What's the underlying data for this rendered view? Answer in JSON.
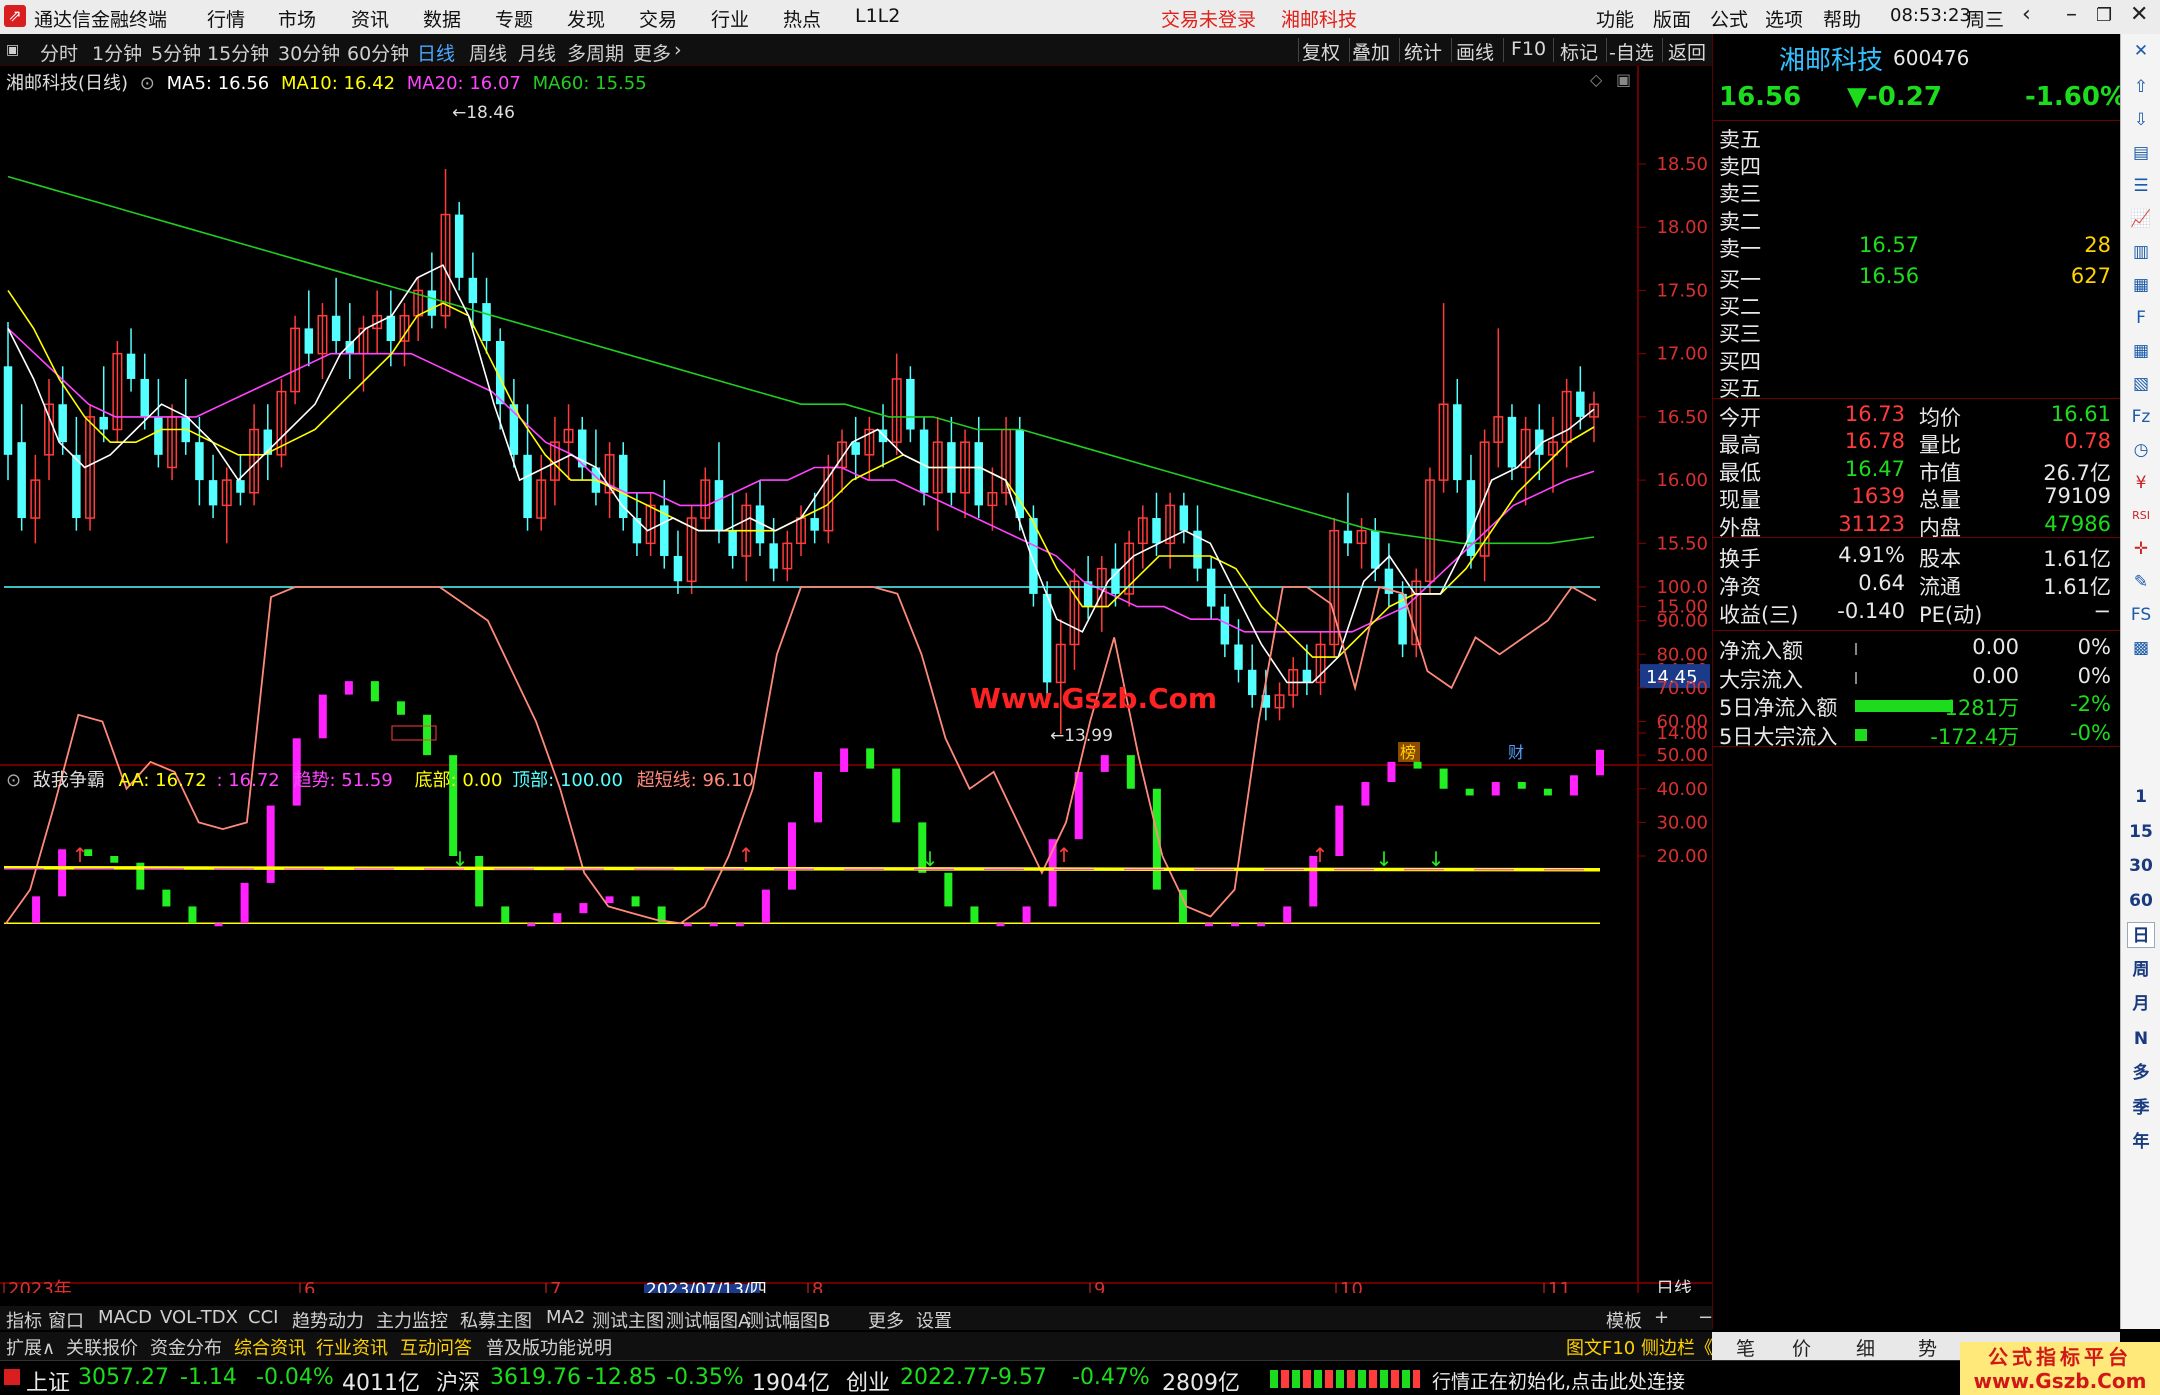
{
  "titlebar": {
    "app_name": "通达信金融终端",
    "menus": [
      "行情",
      "市场",
      "资讯",
      "数据",
      "专题",
      "发现",
      "交易",
      "行业",
      "热点",
      "L1L2"
    ],
    "login_status": "交易未登录",
    "current_stock": "湘邮科技",
    "right_menus": [
      "功能",
      "版面",
      "公式",
      "选项",
      "帮助"
    ],
    "clock": "08:53:23",
    "weekday": "周三"
  },
  "periodbar": {
    "periods": [
      "分时",
      "1分钟",
      "5分钟",
      "15分钟",
      "30分钟",
      "60分钟",
      "日线",
      "周线",
      "月线",
      "多周期",
      "更多"
    ],
    "active": "日线",
    "tools": [
      "复权",
      "叠加",
      "统计",
      "画线",
      "F10",
      "标记",
      "-自选",
      "返回"
    ]
  },
  "main_chart": {
    "legend_title": "湘邮科技(日线)",
    "ma5_label": "MA5: 16.56",
    "ma10_label": "MA10: 16.42",
    "ma20_label": "MA20: 16.07",
    "ma60_label": "MA60: 15.55",
    "high_mark": "18.46",
    "low_mark": "13.99",
    "price_axis": [
      "18.50",
      "18.00",
      "17.50",
      "17.00",
      "16.50",
      "16.00",
      "15.50",
      "15.00",
      "14.50",
      "14.00"
    ],
    "cursor_price": "14.45",
    "badge_bang": "榜",
    "badge_cai": "财",
    "colors": {
      "up": "#ff3b3b",
      "down": "#54ffff",
      "ma5": "#ffffff",
      "ma10": "#ffff00",
      "ma20": "#ff44ff",
      "ma60": "#22cc22"
    }
  },
  "indicator": {
    "name": "敌我争霸",
    "aa_label": "AA: 16.72",
    "aa2_label": ": 16.72",
    "trend_label": "趋势: 51.59",
    "bottom_label": "底部: 0.00",
    "top_label": "顶部: 100.00",
    "overshort_label": "超短线: 96.10",
    "axis": [
      "100.0",
      "90.00",
      "80.00",
      "70.00",
      "60.00",
      "50.00",
      "40.00",
      "30.00",
      "20.00"
    ]
  },
  "date_axis": {
    "labels": [
      "2023年",
      "6",
      "7",
      "8",
      "9",
      "10",
      "11"
    ],
    "cursor_date": "2023/07/13/四",
    "period": "日线"
  },
  "bottom_tabs": [
    "指标",
    "窗口",
    "MACD",
    "VOL-TDX",
    "CCI",
    "趋势动力",
    "主力监控",
    "私募主图",
    "MA2",
    "测试主图",
    "测试幅图A",
    "测试幅图B",
    "更多",
    "设置"
  ],
  "bottom_tabs_right": [
    "模板",
    "+",
    "−"
  ],
  "bottom_tabs2": [
    "扩展∧",
    "关联报价",
    "资金分布",
    "综合资讯",
    "行业资讯",
    "互动问答",
    "普及版功能说明"
  ],
  "bottom_tabs2_right": "图文F10 侧边栏《",
  "quote": {
    "name": "湘邮科技",
    "code": "600476",
    "price": "16.56",
    "change": "▼-0.27",
    "pct": "-1.60%",
    "sell": [
      {
        "label": "卖五",
        "price": "",
        "vol": ""
      },
      {
        "label": "卖四",
        "price": "",
        "vol": ""
      },
      {
        "label": "卖三",
        "price": "",
        "vol": ""
      },
      {
        "label": "卖二",
        "price": "",
        "vol": ""
      },
      {
        "label": "卖一",
        "price": "16.57",
        "vol": "28"
      }
    ],
    "buy": [
      {
        "label": "买一",
        "price": "16.56",
        "vol": "627"
      },
      {
        "label": "买二",
        "price": "",
        "vol": ""
      },
      {
        "label": "买三",
        "price": "",
        "vol": ""
      },
      {
        "label": "买四",
        "price": "",
        "vol": ""
      },
      {
        "label": "买五",
        "price": "",
        "vol": ""
      }
    ],
    "stats": [
      {
        "l1": "今开",
        "v1": "16.73",
        "l2": "均价",
        "v2": "16.61"
      },
      {
        "l1": "最高",
        "v1": "16.78",
        "l2": "量比",
        "v2": "0.78"
      },
      {
        "l1": "最低",
        "v1": "16.47",
        "l2": "市值",
        "v2": "26.7亿"
      },
      {
        "l1": "现量",
        "v1": "1639",
        "l2": "总量",
        "v2": "79109"
      },
      {
        "l1": "外盘",
        "v1": "31123",
        "l2": "内盘",
        "v2": "47986"
      }
    ],
    "stats2": [
      {
        "l1": "换手",
        "v1": "4.91%",
        "l2": "股本",
        "v2": "1.61亿"
      },
      {
        "l1": "净资",
        "v1": "0.64",
        "l2": "流通",
        "v2": "1.61亿"
      },
      {
        "l1": "收益(三)",
        "v1": "-0.140",
        "l2": "PE(动)",
        "v2": "−"
      }
    ],
    "flows": [
      {
        "label": "净流入额",
        "val": "0.00",
        "pct": "0%",
        "bar": 0.0
      },
      {
        "label": "大宗流入",
        "val": "0.00",
        "pct": "0%",
        "bar": 0.0
      },
      {
        "label": "5日净流入额",
        "val": "-1281万",
        "pct": "-2%",
        "bar": 0.94
      },
      {
        "label": "5日大宗流入",
        "val": "-172.4万",
        "pct": "-0%",
        "bar": 0.12
      }
    ]
  },
  "right_tabs": [
    "笔",
    "价",
    "细",
    "势"
  ],
  "side_icons": [
    "up-arrow-icon",
    "down-arrow-icon",
    "quote-icon",
    "list-icon",
    "chart-icon",
    "kline-icon",
    "news-icon",
    "f10-icon",
    "grid-icon",
    "news2-icon",
    "fz-icon",
    "clock-icon",
    "money-icon",
    "rsi-icon",
    "crosshair-icon",
    "pen-icon",
    "fs-icon",
    "vol-icon"
  ],
  "side_periods": [
    "1",
    "15",
    "30",
    "60",
    "日",
    "周",
    "月",
    "N",
    "多",
    "季",
    "年"
  ],
  "statusbar": {
    "sh": {
      "name": "上证",
      "val": "3057.27",
      "chg": "-1.14",
      "pct": "-0.04%",
      "amt": "4011亿"
    },
    "hs": {
      "name": "沪深",
      "val": "3619.76",
      "chg": "-12.85",
      "pct": "-0.35%",
      "amt": "1904亿"
    },
    "cy": {
      "name": "创业",
      "val": "2022.77",
      "chg": "-9.57",
      "pct": "-0.47%",
      "amt": "2809亿"
    },
    "message": "行情正在初始化,点击此处连接"
  },
  "watermarks": {
    "center": "Www.Gszb.Com",
    "corner_line1": "公式指标平台",
    "corner_line2": "www.Gszb.Com"
  },
  "chart_data": {
    "type": "candlestick",
    "ohlc_note": "daily candles approximating chart, price units",
    "candles": [
      [
        16.9,
        17.25,
        16.0,
        16.2
      ],
      [
        16.3,
        16.6,
        15.6,
        15.7
      ],
      [
        15.7,
        16.2,
        15.5,
        16.0
      ],
      [
        16.2,
        16.8,
        16.0,
        16.6
      ],
      [
        16.6,
        16.9,
        16.2,
        16.3
      ],
      [
        16.2,
        16.5,
        15.6,
        15.7
      ],
      [
        15.7,
        16.6,
        15.6,
        16.5
      ],
      [
        16.5,
        16.9,
        16.3,
        16.4
      ],
      [
        16.4,
        17.1,
        16.3,
        17.0
      ],
      [
        17.0,
        17.2,
        16.7,
        16.8
      ],
      [
        16.8,
        17.0,
        16.4,
        16.5
      ],
      [
        16.5,
        16.8,
        16.1,
        16.2
      ],
      [
        16.1,
        16.6,
        16.0,
        16.5
      ],
      [
        16.5,
        16.8,
        16.2,
        16.3
      ],
      [
        16.3,
        16.5,
        15.8,
        16.0
      ],
      [
        16.0,
        16.2,
        15.7,
        15.8
      ],
      [
        15.8,
        16.1,
        15.5,
        16.0
      ],
      [
        16.0,
        16.2,
        15.8,
        15.9
      ],
      [
        15.9,
        16.6,
        15.8,
        16.4
      ],
      [
        16.4,
        16.6,
        16.0,
        16.2
      ],
      [
        16.2,
        16.8,
        16.1,
        16.7
      ],
      [
        16.7,
        17.3,
        16.6,
        17.2
      ],
      [
        17.2,
        17.5,
        16.9,
        17.0
      ],
      [
        17.0,
        17.4,
        16.8,
        17.3
      ],
      [
        17.3,
        17.6,
        17.0,
        17.1
      ],
      [
        17.1,
        17.4,
        16.8,
        17.0
      ],
      [
        17.0,
        17.3,
        16.7,
        17.2
      ],
      [
        17.2,
        17.5,
        17.0,
        17.3
      ],
      [
        17.3,
        17.5,
        16.9,
        17.1
      ],
      [
        17.1,
        17.4,
        16.9,
        17.3
      ],
      [
        17.3,
        17.6,
        17.1,
        17.5
      ],
      [
        17.5,
        17.8,
        17.2,
        17.3
      ],
      [
        17.3,
        18.46,
        17.2,
        18.1
      ],
      [
        18.1,
        18.2,
        17.5,
        17.6
      ],
      [
        17.6,
        17.8,
        17.2,
        17.4
      ],
      [
        17.4,
        17.6,
        17.0,
        17.1
      ],
      [
        17.1,
        17.2,
        16.4,
        16.6
      ],
      [
        16.6,
        16.8,
        16.1,
        16.2
      ],
      [
        16.2,
        16.6,
        15.6,
        15.7
      ],
      [
        15.7,
        16.2,
        15.6,
        16.0
      ],
      [
        16.0,
        16.5,
        15.8,
        16.3
      ],
      [
        16.3,
        16.6,
        16.0,
        16.4
      ],
      [
        16.4,
        16.5,
        16.0,
        16.1
      ],
      [
        16.1,
        16.4,
        15.8,
        15.9
      ],
      [
        15.9,
        16.3,
        15.7,
        16.2
      ],
      [
        16.2,
        16.3,
        15.6,
        15.7
      ],
      [
        15.7,
        15.9,
        15.4,
        15.5
      ],
      [
        15.5,
        15.9,
        15.4,
        15.8
      ],
      [
        15.8,
        16.0,
        15.3,
        15.4
      ],
      [
        15.4,
        15.6,
        15.1,
        15.2
      ],
      [
        15.2,
        15.8,
        15.1,
        15.7
      ],
      [
        15.7,
        16.1,
        15.6,
        16.0
      ],
      [
        16.0,
        16.3,
        15.5,
        15.6
      ],
      [
        15.6,
        15.9,
        15.3,
        15.4
      ],
      [
        15.4,
        15.9,
        15.2,
        15.8
      ],
      [
        15.8,
        16.0,
        15.4,
        15.5
      ],
      [
        15.5,
        15.7,
        15.2,
        15.3
      ],
      [
        15.3,
        15.6,
        15.2,
        15.5
      ],
      [
        15.5,
        15.8,
        15.4,
        15.7
      ],
      [
        15.7,
        15.9,
        15.5,
        15.6
      ],
      [
        15.6,
        16.2,
        15.5,
        16.1
      ],
      [
        16.1,
        16.4,
        15.9,
        16.3
      ],
      [
        16.3,
        16.5,
        16.0,
        16.2
      ],
      [
        16.2,
        16.5,
        16.0,
        16.4
      ],
      [
        16.4,
        16.6,
        16.1,
        16.3
      ],
      [
        16.3,
        17.0,
        16.2,
        16.8
      ],
      [
        16.8,
        16.9,
        16.3,
        16.4
      ],
      [
        16.4,
        16.5,
        15.8,
        15.9
      ],
      [
        15.9,
        16.5,
        15.6,
        16.3
      ],
      [
        16.3,
        16.5,
        15.8,
        15.9
      ],
      [
        15.9,
        16.4,
        15.7,
        16.3
      ],
      [
        16.3,
        16.5,
        15.7,
        15.8
      ],
      [
        15.8,
        16.1,
        15.6,
        15.9
      ],
      [
        15.9,
        16.5,
        15.8,
        16.4
      ],
      [
        16.4,
        16.5,
        15.6,
        15.7
      ],
      [
        15.7,
        15.8,
        15.0,
        15.1
      ],
      [
        15.1,
        15.2,
        14.2,
        14.4
      ],
      [
        14.4,
        14.9,
        13.99,
        14.7
      ],
      [
        14.7,
        15.3,
        14.5,
        15.2
      ],
      [
        15.2,
        15.4,
        14.9,
        15.0
      ],
      [
        15.0,
        15.4,
        14.8,
        15.3
      ],
      [
        15.3,
        15.5,
        15.0,
        15.1
      ],
      [
        15.1,
        15.6,
        15.0,
        15.5
      ],
      [
        15.5,
        15.8,
        15.3,
        15.7
      ],
      [
        15.7,
        15.9,
        15.4,
        15.5
      ],
      [
        15.5,
        15.9,
        15.3,
        15.8
      ],
      [
        15.8,
        15.9,
        15.5,
        15.6
      ],
      [
        15.6,
        15.8,
        15.2,
        15.3
      ],
      [
        15.3,
        15.4,
        14.9,
        15.0
      ],
      [
        15.0,
        15.1,
        14.6,
        14.7
      ],
      [
        14.7,
        14.9,
        14.4,
        14.5
      ],
      [
        14.5,
        14.7,
        14.2,
        14.3
      ],
      [
        14.3,
        14.5,
        14.1,
        14.2
      ],
      [
        14.2,
        14.4,
        14.1,
        14.3
      ],
      [
        14.3,
        14.6,
        14.2,
        14.5
      ],
      [
        14.5,
        14.7,
        14.3,
        14.4
      ],
      [
        14.4,
        14.8,
        14.3,
        14.7
      ],
      [
        14.7,
        15.7,
        14.6,
        15.6
      ],
      [
        15.6,
        15.9,
        15.4,
        15.5
      ],
      [
        15.5,
        15.7,
        15.3,
        15.6
      ],
      [
        15.6,
        15.7,
        15.2,
        15.3
      ],
      [
        15.3,
        15.5,
        15.0,
        15.1
      ],
      [
        15.1,
        15.2,
        14.6,
        14.7
      ],
      [
        14.7,
        15.3,
        14.6,
        15.2
      ],
      [
        15.2,
        16.1,
        15.1,
        16.0
      ],
      [
        16.0,
        17.4,
        15.9,
        16.6
      ],
      [
        16.6,
        16.8,
        15.9,
        16.0
      ],
      [
        16.0,
        16.2,
        15.3,
        15.4
      ],
      [
        15.4,
        16.4,
        15.2,
        16.3
      ],
      [
        16.3,
        17.2,
        16.1,
        16.5
      ],
      [
        16.5,
        16.6,
        16.0,
        16.1
      ],
      [
        16.1,
        16.5,
        15.8,
        16.4
      ],
      [
        16.4,
        16.6,
        16.0,
        16.2
      ],
      [
        16.2,
        16.5,
        15.9,
        16.3
      ],
      [
        16.3,
        16.8,
        16.1,
        16.7
      ],
      [
        16.7,
        16.9,
        16.4,
        16.5
      ],
      [
        16.5,
        16.7,
        16.3,
        16.6
      ]
    ],
    "ma": {
      "ma5": [
        17.2,
        16.8,
        16.3,
        16.1,
        16.2,
        16.4,
        16.6,
        16.5,
        16.3,
        16.0,
        16.2,
        16.4,
        16.6,
        17.0,
        17.2,
        17.3,
        17.6,
        17.7,
        17.3,
        16.6,
        16.0,
        16.1,
        16.2,
        16.1,
        15.8,
        15.6,
        15.7,
        15.6,
        15.6,
        15.7,
        15.6,
        15.7,
        16.0,
        16.3,
        16.4,
        16.2,
        16.1,
        16.1,
        16.1,
        16.0,
        15.4,
        14.9,
        14.8,
        15.2,
        15.4,
        15.5,
        15.6,
        15.5,
        15.1,
        14.7,
        14.4,
        14.4,
        14.6,
        15.2,
        15.4,
        15.1,
        15.1,
        15.5,
        16.0,
        16.1,
        16.3,
        16.4,
        16.56
      ],
      "ma10": [
        17.5,
        17.2,
        16.8,
        16.5,
        16.3,
        16.3,
        16.4,
        16.4,
        16.3,
        16.2,
        16.2,
        16.3,
        16.4,
        16.6,
        16.8,
        17.0,
        17.3,
        17.4,
        17.3,
        16.9,
        16.5,
        16.2,
        16.0,
        16.0,
        15.9,
        15.8,
        15.7,
        15.6,
        15.6,
        15.6,
        15.6,
        15.7,
        15.8,
        16.0,
        16.1,
        16.2,
        16.1,
        16.1,
        16.1,
        16.0,
        15.7,
        15.3,
        15.0,
        15.0,
        15.2,
        15.4,
        15.4,
        15.4,
        15.3,
        15.0,
        14.8,
        14.6,
        14.6,
        14.8,
        15.0,
        15.1,
        15.1,
        15.3,
        15.6,
        15.9,
        16.1,
        16.3,
        16.42
      ],
      "ma20": [
        17.2,
        17.0,
        16.8,
        16.6,
        16.5,
        16.5,
        16.5,
        16.5,
        16.6,
        16.7,
        16.8,
        16.9,
        17.0,
        17.0,
        17.0,
        17.0,
        16.9,
        16.8,
        16.7,
        16.5,
        16.3,
        16.2,
        16.0,
        15.9,
        15.9,
        15.8,
        15.8,
        15.9,
        16.0,
        16.0,
        16.1,
        16.1,
        16.0,
        16.0,
        15.9,
        15.8,
        15.7,
        15.6,
        15.5,
        15.4,
        15.2,
        15.1,
        15.0,
        15.0,
        14.9,
        14.9,
        14.8,
        14.8,
        14.8,
        14.8,
        14.8,
        14.9,
        15.0,
        15.2,
        15.4,
        15.6,
        15.8,
        15.9,
        16.0,
        16.07
      ],
      "ma60": [
        18.4,
        18.3,
        18.2,
        18.1,
        18.0,
        17.9,
        17.8,
        17.7,
        17.6,
        17.5,
        17.4,
        17.3,
        17.2,
        17.1,
        17.0,
        16.9,
        16.8,
        16.7,
        16.6,
        16.6,
        16.5,
        16.5,
        16.4,
        16.4,
        16.3,
        16.2,
        16.1,
        16.0,
        15.9,
        15.8,
        15.7,
        15.6,
        15.55,
        15.5,
        15.5,
        15.5,
        15.55
      ]
    },
    "indicator_series": {
      "overshort_line": [
        0,
        10,
        35,
        62,
        60,
        40,
        48,
        45,
        30,
        28,
        30,
        97,
        100,
        100,
        100,
        100,
        100,
        100,
        100,
        95,
        90,
        75,
        60,
        40,
        15,
        5,
        3,
        1,
        0,
        5,
        20,
        40,
        80,
        100,
        100,
        100,
        100,
        98,
        80,
        55,
        40,
        45,
        30,
        15,
        30,
        60,
        85,
        50,
        20,
        5,
        2,
        10,
        60,
        100,
        100,
        95,
        70,
        100,
        98,
        75,
        70,
        85,
        80,
        85,
        90,
        100,
        96
      ],
      "trend_bars": [
        0,
        8,
        22,
        20,
        18,
        10,
        5,
        0,
        0,
        12,
        35,
        55,
        68,
        72,
        66,
        62,
        50,
        20,
        5,
        0,
        0,
        3,
        6,
        8,
        5,
        0,
        0,
        0,
        0,
        10,
        30,
        45,
        52,
        46,
        30,
        15,
        5,
        0,
        0,
        5,
        25,
        45,
        50,
        40,
        10,
        0,
        0,
        0,
        0,
        5,
        20,
        35,
        42,
        48,
        46,
        40,
        38,
        42,
        40,
        38,
        44,
        51.59
      ],
      "aa_line_level": 16.5
    }
  }
}
